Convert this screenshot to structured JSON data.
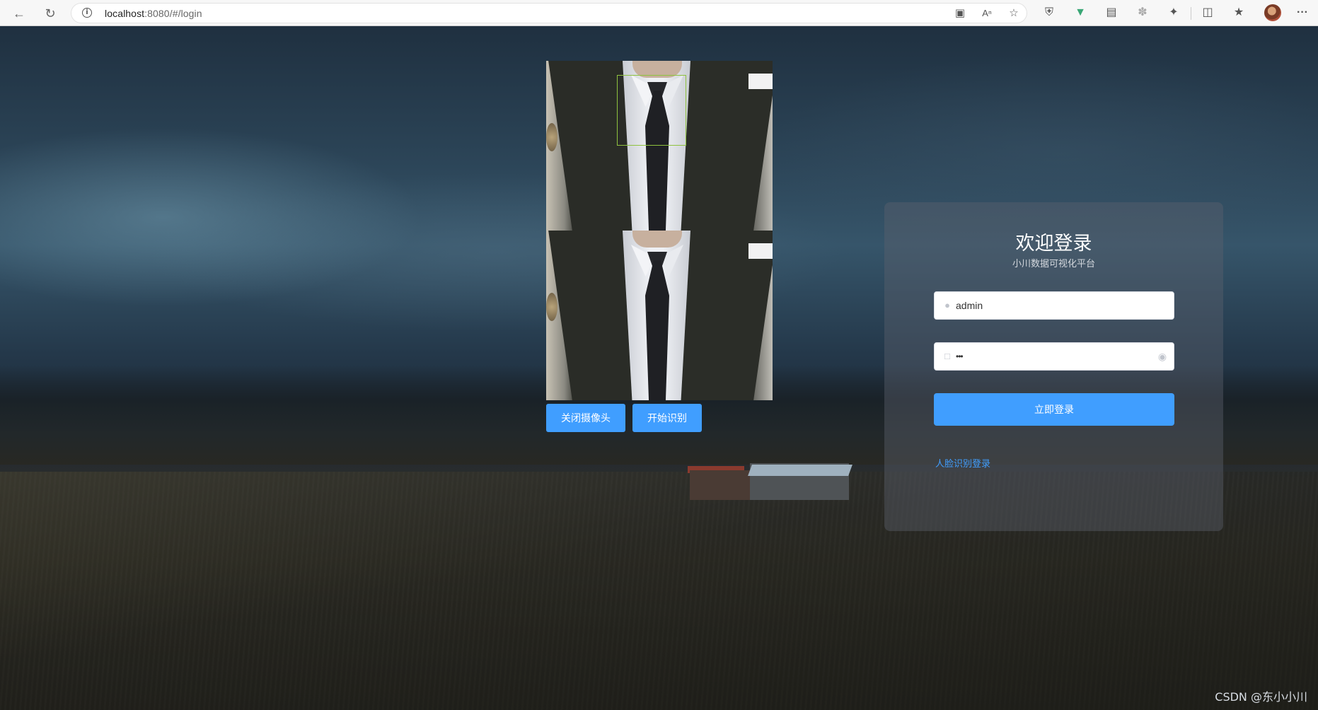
{
  "browser": {
    "url_host": "localhost",
    "url_rest_port": ":8080",
    "url_path": "/#/login",
    "icons": [
      "back-icon",
      "refresh-icon",
      "info-icon",
      "camera-icon",
      "read-aloud-icon",
      "favorite-add-icon",
      "shield-extension-icon",
      "vue-devtools-icon",
      "collections-icon",
      "extension-gray-icon",
      "extensions-icon",
      "split-screen-icon",
      "favorites-icon",
      "profile-avatar",
      "more-icon"
    ]
  },
  "camera": {
    "close_label": "关闭摄像头",
    "recognize_label": "开始识别"
  },
  "login": {
    "title": "欢迎登录",
    "subtitle": "小川数据可视化平台",
    "username": "admin",
    "password_mask": "•••",
    "submit_label": "立即登录",
    "face_login_link": "人脸识别登录"
  },
  "watermark": "CSDN @东小小川",
  "colors": {
    "primary": "#409eff",
    "face_box": "#8fc23f"
  }
}
